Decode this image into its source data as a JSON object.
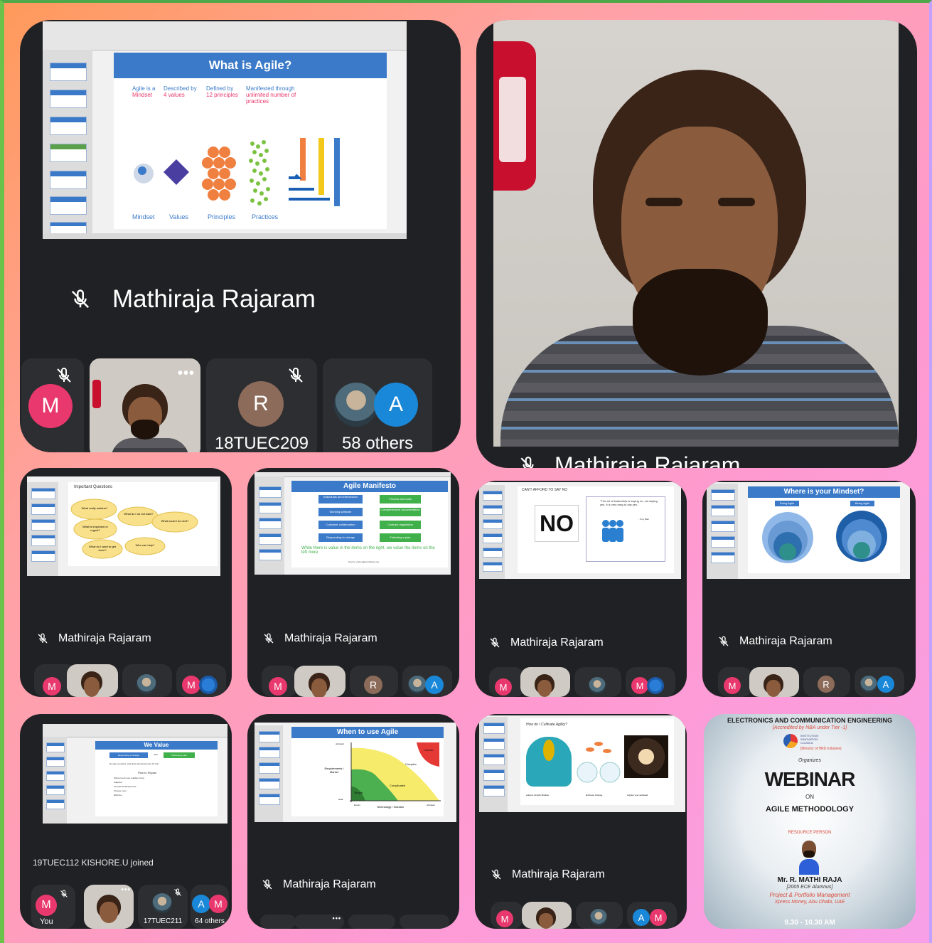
{
  "presenter_name": "Mathiraja Rajaram",
  "participants": {
    "you_label": "You",
    "p1": "18TUEC209",
    "p2": "17TUEC211",
    "others_58": "58 others",
    "others_64": "64 others",
    "avatar_m": "M",
    "avatar_r": "R",
    "avatar_a": "A"
  },
  "notification": "19TUEC112 KISHORE.U joined",
  "slides": {
    "what_is_agile": {
      "title": "What is Agile?",
      "cols": [
        {
          "head": "Agile is a",
          "sub": "Mindset"
        },
        {
          "head": "Described by",
          "sub": "4 values"
        },
        {
          "head": "Defined by",
          "sub": "12 principles"
        },
        {
          "head": "Manifested through",
          "sub": "unlimited number of practices"
        }
      ],
      "labels": [
        "Mindset",
        "Values",
        "Principles",
        "Practices"
      ],
      "bar_letters": [
        "S",
        "c",
        "r",
        "u",
        "m",
        "X",
        "P",
        "K",
        "a",
        "n"
      ]
    },
    "important_questions": {
      "title": "Important Questions",
      "bubbles": [
        "What really matters?",
        "What do I do not want?",
        "What is important or urgent?",
        "What could I do next?",
        "What do I want to get done?",
        "Who can help?"
      ]
    },
    "agile_manifesto": {
      "title": "Agile Manifesto",
      "left": [
        "Individuals and interactions",
        "Working software",
        "Customer collaboration",
        "Responding to change"
      ],
      "over": "over",
      "right": [
        "Process and tools",
        "Comprehensive documentation",
        "Contract negotiation",
        "Following a plan"
      ],
      "note": "While there is value in the items on the right, we value the items on the left more",
      "source": "Source: www.agilemanifesto.org"
    },
    "cant_afford": {
      "title": "CAN'T AFFORD TO SAY NO",
      "sign": "NO",
      "quote": "\"The art of leadership is saying no, not saying yes. It is very easy to say yes.\"",
      "attr": "- Tony Blair"
    },
    "where_mindset": {
      "title": "Where is your Mindset?",
      "left_tag": "Doing Agile",
      "right_tag": "Being Agile",
      "rings": [
        "Values",
        "Principles",
        "Mindset",
        "Practices & Tools"
      ]
    },
    "we_value": {
      "title": "We Value",
      "left": "Responding to change",
      "over": "over",
      "right": "Following a plan",
      "text": "No plan is perfect, and plans should account for that",
      "sub": "Plan to Replan",
      "bullets": [
        "Shorter and more reliable timing",
        "Adaptive",
        "Test-Driven/Responsive",
        "Choose more",
        "Effective"
      ]
    },
    "when_agile": {
      "title": "When to use Agile",
      "zones": [
        "Chaotic",
        "Complex",
        "Complicated",
        "Simple"
      ],
      "ylabel": "Requirements / Market",
      "xlabel": "Technology / Solution",
      "y_top": "unknown",
      "y_bot": "clear",
      "x_left": "known",
      "x_right": "unknown",
      "zone_subs": [
        "Agile",
        "Traditional"
      ]
    },
    "cultivate": {
      "title": "How do I Cultivate Agility?",
      "captions": [
        "Adopt a Growth Mindset",
        "Embrace Change",
        "Lighten your workload"
      ]
    }
  },
  "webinar": {
    "dept": "ELECTRONICS AND COMMUNICATION ENGINEERING",
    "accred": "[Accredited by NBA under Tier -1]",
    "council": [
      "INSTITUTION",
      "INNOVATION",
      "COUNCIL"
    ],
    "ministry": "[Ministry of HRD Initiative]",
    "organizes": "Organizes",
    "title": "WEBINAR",
    "on": "ON",
    "topic": "AGILE METHODOLOGY",
    "rp_label": "RESOURCE PERSON",
    "rp_name": "Mr. R. MATHI RAJA",
    "rp_alumni": "[2005 ECE Alumnus]",
    "rp_role": "Project & Portfolio Management",
    "rp_org": "Xpress Money, Abu Dhabi, UAE",
    "time": "9.30 - 10.30 AM"
  },
  "colors": {
    "mic_off": "#ffffff",
    "tile": "#2d2e31",
    "card": "#202124",
    "slide_blue": "#3b7ac9",
    "green_btn": "#3fb04a"
  },
  "icons": [
    "mic-off-icon",
    "more-icon"
  ]
}
